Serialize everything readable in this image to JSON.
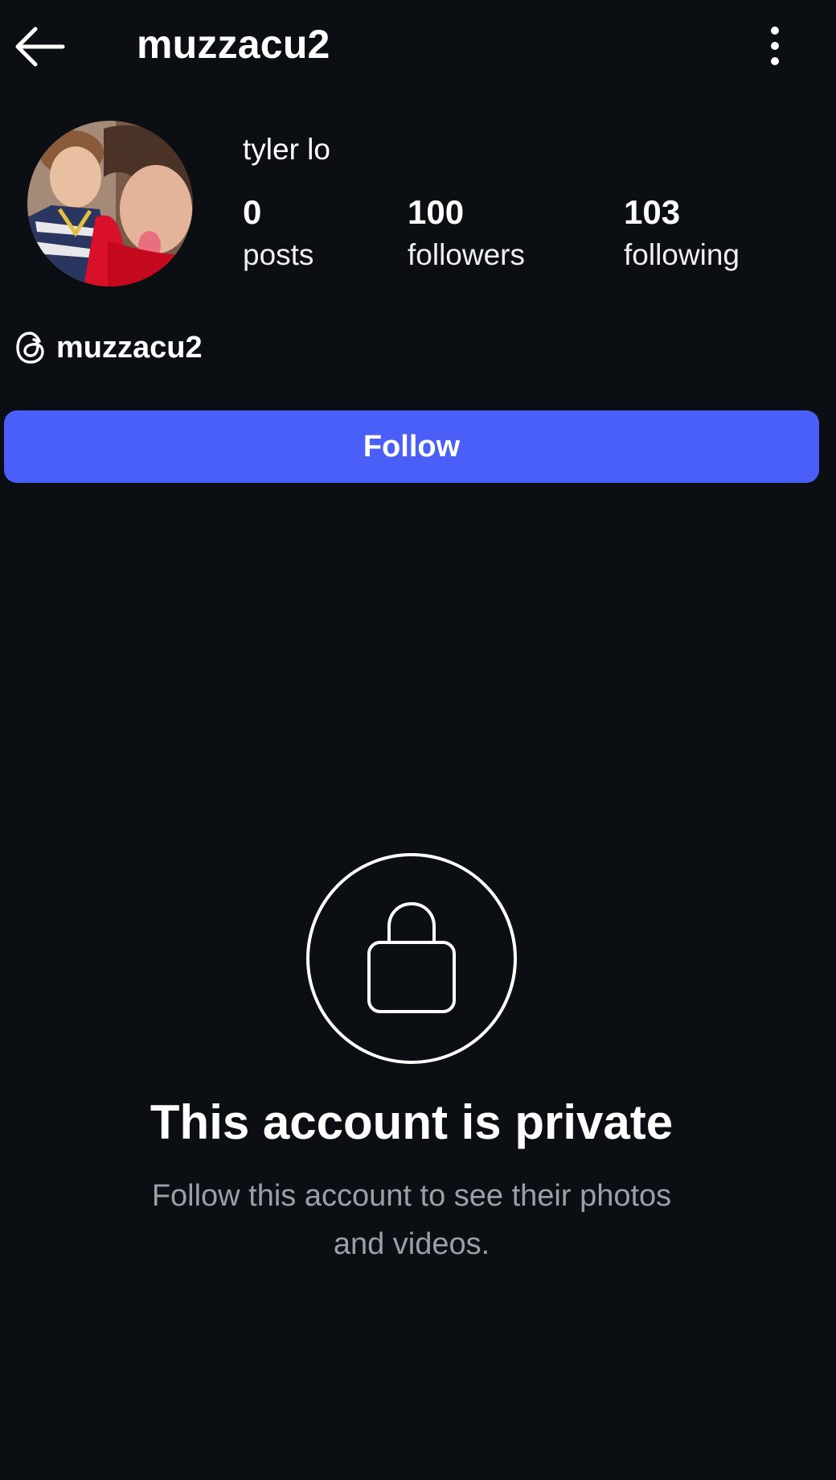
{
  "header": {
    "username": "muzzacu2",
    "back_icon": "arrow-left-icon",
    "more_icon": "vertical-dots-icon"
  },
  "profile": {
    "display_name": "tyler lo",
    "avatar": "profile-photo",
    "stats": [
      {
        "count": "0",
        "label": "posts"
      },
      {
        "count": "100",
        "label": "followers"
      },
      {
        "count": "103",
        "label": "following"
      }
    ],
    "threads": {
      "icon": "threads-icon",
      "handle": "muzzacu2"
    }
  },
  "actions": {
    "follow_label": "Follow",
    "follow_color": "#4a5ef8"
  },
  "private_notice": {
    "icon": "lock-icon",
    "title": "This account is private",
    "subtitle": "Follow this account to see their photos and videos."
  },
  "colors": {
    "background": "#0b0e13",
    "text": "#ffffff",
    "muted_text": "#9aa0a8"
  }
}
